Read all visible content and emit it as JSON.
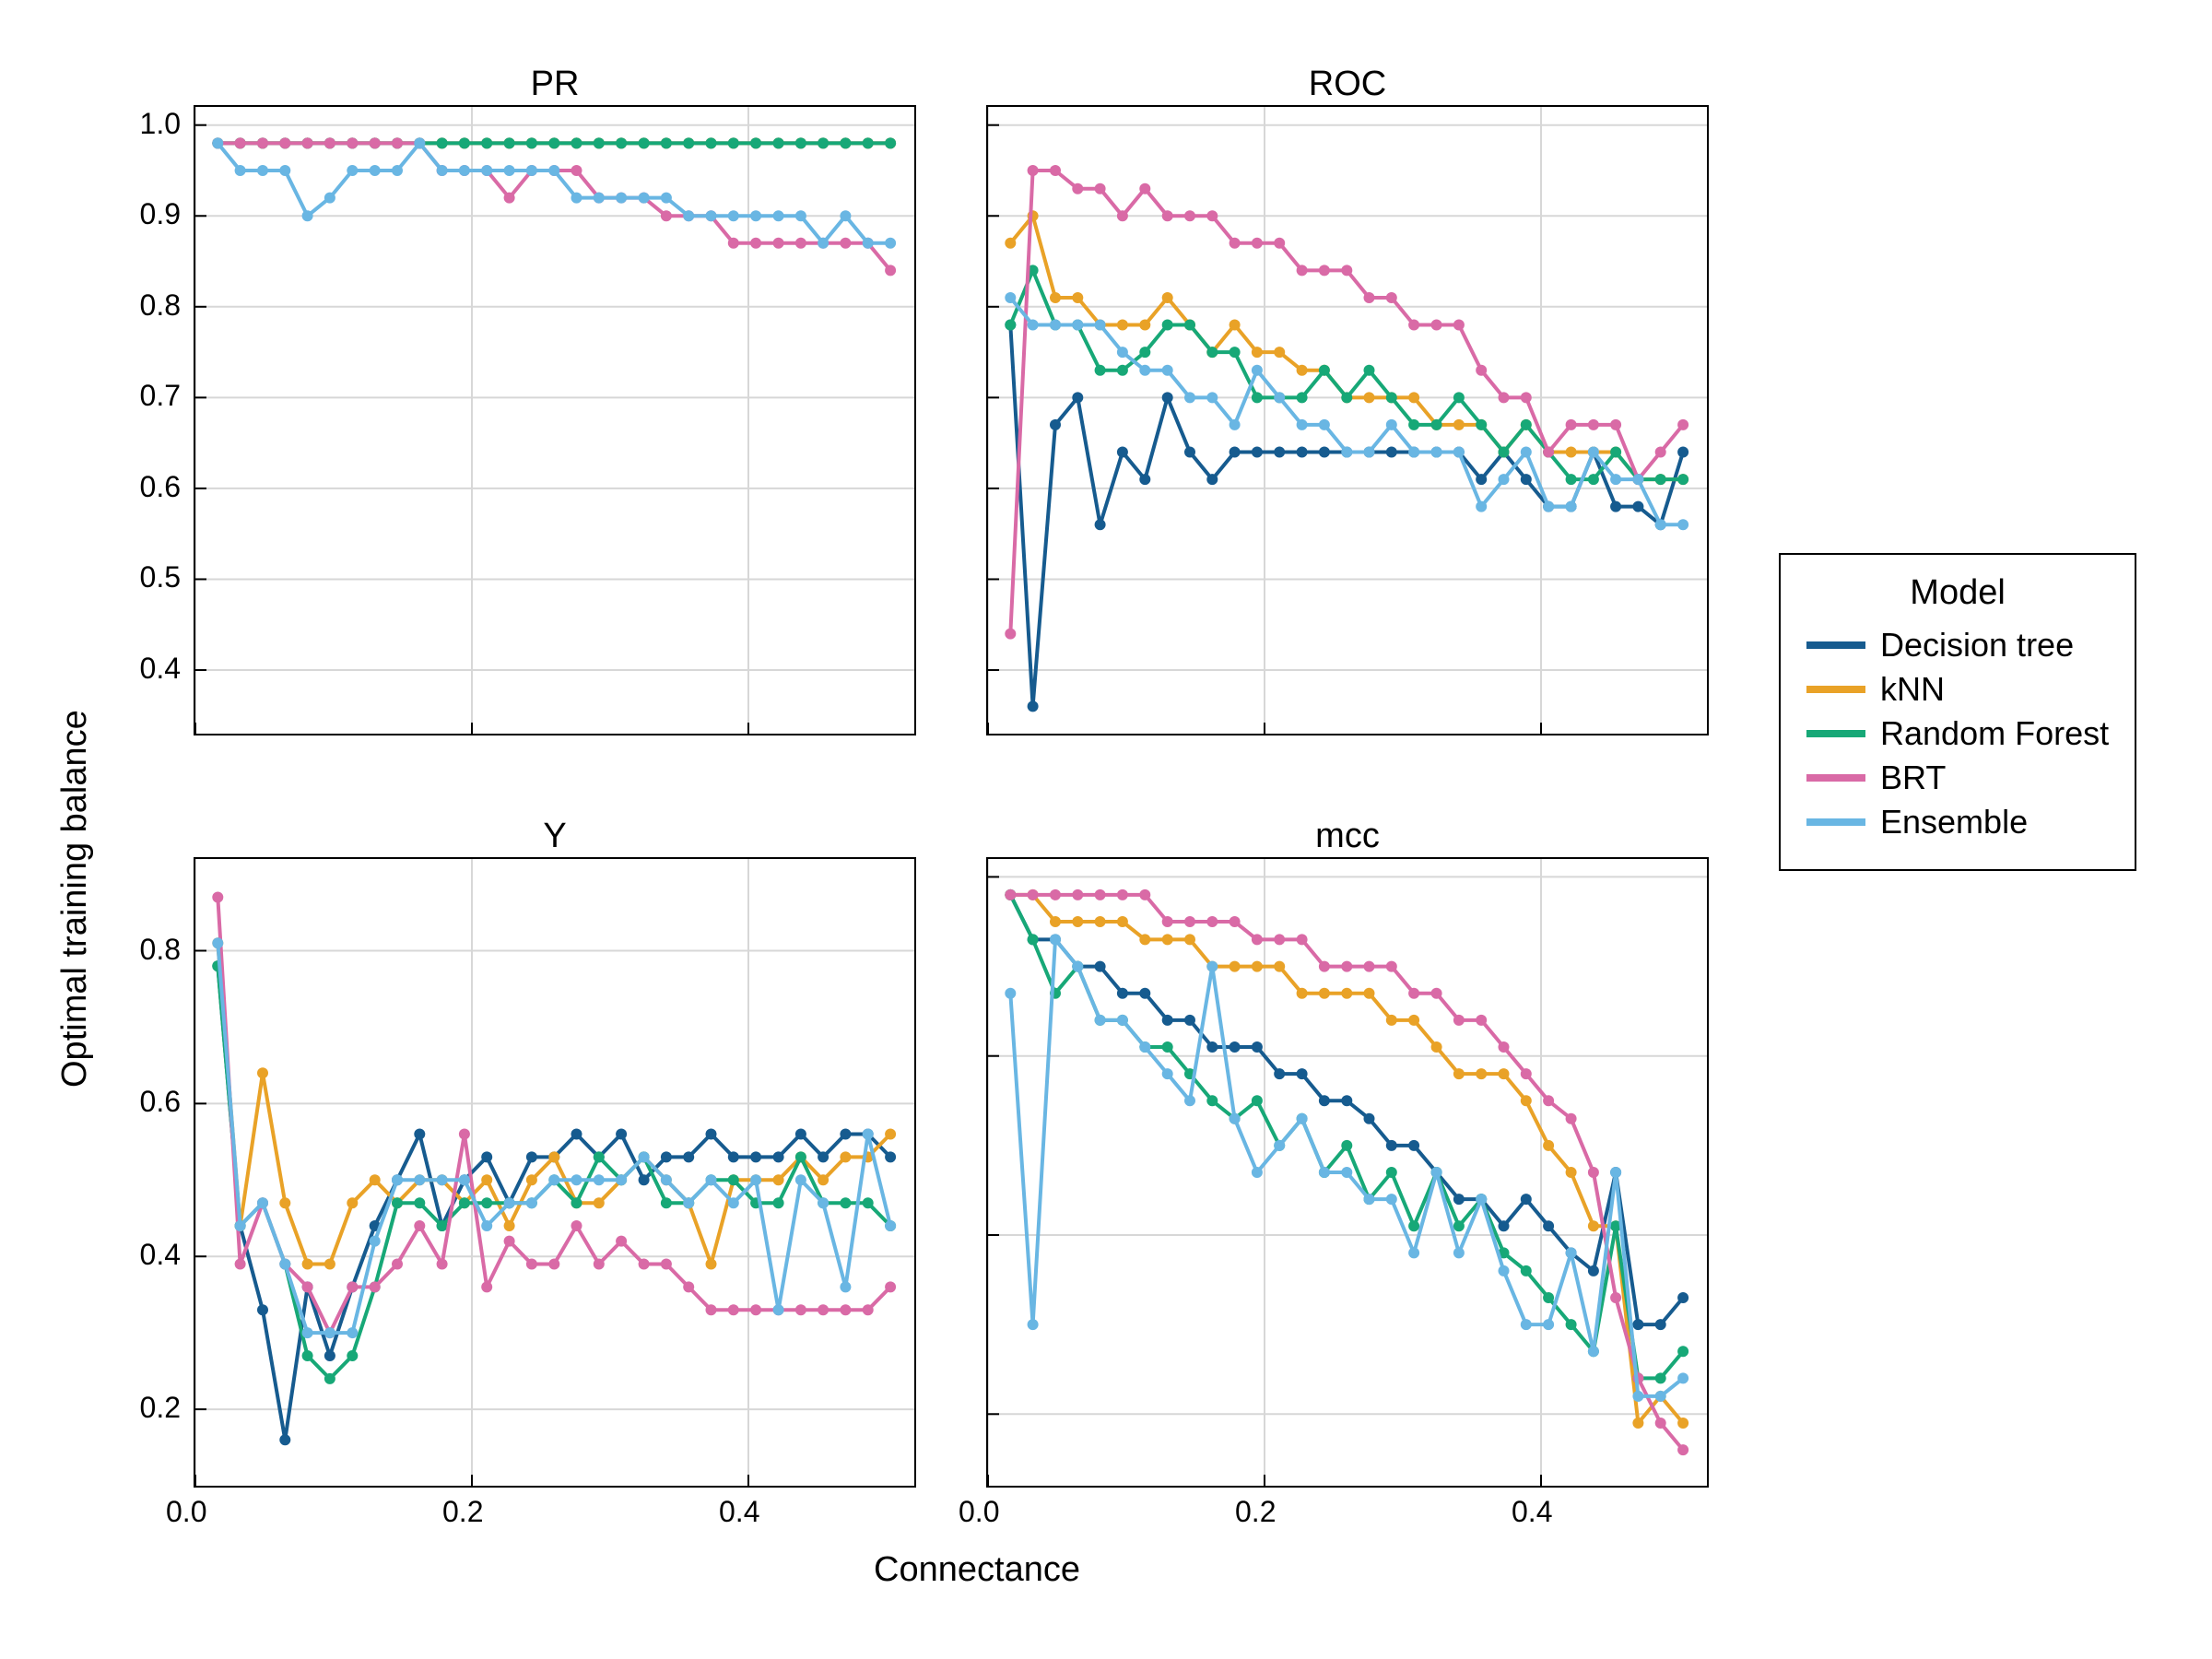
{
  "xlabel": "Connectance",
  "ylabel": "Optimal training balance",
  "x_values": [
    0.0162,
    0.0324,
    0.0487,
    0.0649,
    0.0811,
    0.0973,
    0.1135,
    0.1298,
    0.146,
    0.1622,
    0.1784,
    0.1946,
    0.2108,
    0.2271,
    0.2433,
    0.2595,
    0.2757,
    0.2919,
    0.3081,
    0.3244,
    0.3406,
    0.3568,
    0.373,
    0.3892,
    0.4054,
    0.4217,
    0.4379,
    0.4541,
    0.4703,
    0.4865,
    0.5027
  ],
  "x_ticks": [
    0.0,
    0.2,
    0.4
  ],
  "legend": {
    "title": "Model",
    "entries": [
      {
        "name": "Decision tree",
        "color": "#165b8f"
      },
      {
        "name": "kNN",
        "color": "#e9a227"
      },
      {
        "name": "Random Forest",
        "color": "#17a877"
      },
      {
        "name": "BRT",
        "color": "#d96aa6"
      },
      {
        "name": "Ensemble",
        "color": "#69b6e3"
      }
    ]
  },
  "chart_data": [
    {
      "title": "PR",
      "type": "line",
      "xlabel": "Connectance",
      "ylabel": "Optimal training balance",
      "ylim": [
        0.33,
        1.02
      ],
      "xlim": [
        0.0,
        0.52
      ],
      "yticks": [
        0.4,
        0.5,
        0.6,
        0.7,
        0.8,
        0.9,
        1.0
      ],
      "xticks": [
        0.0,
        0.2,
        0.4
      ],
      "series": [
        {
          "name": "Decision tree",
          "color": "#165b8f",
          "values": [
            0.98,
            0.98,
            0.98,
            0.98,
            0.98,
            0.98,
            0.98,
            0.98,
            0.98,
            0.98,
            0.98,
            0.98,
            0.98,
            0.98,
            0.98,
            0.98,
            0.98,
            0.98,
            0.98,
            0.98,
            0.98,
            0.98,
            0.98,
            0.98,
            0.98,
            0.98,
            0.98,
            0.98,
            0.98,
            0.98,
            0.98
          ]
        },
        {
          "name": "kNN",
          "color": "#e9a227",
          "values": [
            0.98,
            0.98,
            0.98,
            0.98,
            0.98,
            0.98,
            0.98,
            0.98,
            0.98,
            0.98,
            0.98,
            0.98,
            0.98,
            0.98,
            0.98,
            0.98,
            0.98,
            0.98,
            0.98,
            0.98,
            0.98,
            0.98,
            0.98,
            0.98,
            0.98,
            0.98,
            0.98,
            0.98,
            0.98,
            0.98,
            0.98
          ]
        },
        {
          "name": "Random Forest",
          "color": "#17a877",
          "values": [
            0.98,
            0.98,
            0.98,
            0.98,
            0.98,
            0.98,
            0.98,
            0.98,
            0.98,
            0.98,
            0.98,
            0.98,
            0.98,
            0.98,
            0.98,
            0.98,
            0.98,
            0.98,
            0.98,
            0.98,
            0.98,
            0.98,
            0.98,
            0.98,
            0.98,
            0.98,
            0.98,
            0.98,
            0.98,
            0.98,
            0.98
          ]
        },
        {
          "name": "BRT",
          "color": "#d96aa6",
          "values": [
            0.98,
            0.98,
            0.98,
            0.98,
            0.98,
            0.98,
            0.98,
            0.98,
            0.98,
            0.98,
            0.95,
            0.95,
            0.95,
            0.92,
            0.95,
            0.95,
            0.95,
            0.92,
            0.92,
            0.92,
            0.9,
            0.9,
            0.9,
            0.87,
            0.87,
            0.87,
            0.87,
            0.87,
            0.87,
            0.87,
            0.84
          ]
        },
        {
          "name": "Ensemble",
          "color": "#69b6e3",
          "values": [
            0.98,
            0.95,
            0.95,
            0.95,
            0.9,
            0.92,
            0.95,
            0.95,
            0.95,
            0.98,
            0.95,
            0.95,
            0.95,
            0.95,
            0.95,
            0.95,
            0.92,
            0.92,
            0.92,
            0.92,
            0.92,
            0.9,
            0.9,
            0.9,
            0.9,
            0.9,
            0.9,
            0.87,
            0.9,
            0.87,
            0.87
          ]
        }
      ]
    },
    {
      "title": "ROC",
      "type": "line",
      "xlabel": "Connectance",
      "ylabel": "Optimal training balance",
      "ylim": [
        0.33,
        1.02
      ],
      "xlim": [
        0.0,
        0.52
      ],
      "yticks": [
        0.4,
        0.5,
        0.6,
        0.7,
        0.8,
        0.9,
        1.0
      ],
      "xticks": [
        0.0,
        0.2,
        0.4
      ],
      "series": [
        {
          "name": "Decision tree",
          "color": "#165b8f",
          "values": [
            0.78,
            0.36,
            0.67,
            0.7,
            0.56,
            0.64,
            0.61,
            0.7,
            0.64,
            0.61,
            0.64,
            0.64,
            0.64,
            0.64,
            0.64,
            0.64,
            0.64,
            0.64,
            0.64,
            0.64,
            0.64,
            0.61,
            0.64,
            0.61,
            0.58,
            0.58,
            0.64,
            0.58,
            0.58,
            0.56,
            0.64
          ]
        },
        {
          "name": "kNN",
          "color": "#e9a227",
          "values": [
            0.87,
            0.9,
            0.81,
            0.81,
            0.78,
            0.78,
            0.78,
            0.81,
            0.78,
            0.75,
            0.78,
            0.75,
            0.75,
            0.73,
            0.73,
            0.7,
            0.7,
            0.7,
            0.7,
            0.67,
            0.67,
            0.67,
            0.64,
            0.67,
            0.64,
            0.64,
            0.64,
            0.64,
            0.61,
            0.61,
            0.61
          ]
        },
        {
          "name": "Random Forest",
          "color": "#17a877",
          "values": [
            0.78,
            0.84,
            0.78,
            0.78,
            0.73,
            0.73,
            0.75,
            0.78,
            0.78,
            0.75,
            0.75,
            0.7,
            0.7,
            0.7,
            0.73,
            0.7,
            0.73,
            0.7,
            0.67,
            0.67,
            0.7,
            0.67,
            0.64,
            0.67,
            0.64,
            0.61,
            0.61,
            0.64,
            0.61,
            0.61,
            0.61
          ]
        },
        {
          "name": "BRT",
          "color": "#d96aa6",
          "values": [
            0.44,
            0.95,
            0.95,
            0.93,
            0.93,
            0.9,
            0.93,
            0.9,
            0.9,
            0.9,
            0.87,
            0.87,
            0.87,
            0.84,
            0.84,
            0.84,
            0.81,
            0.81,
            0.78,
            0.78,
            0.78,
            0.73,
            0.7,
            0.7,
            0.64,
            0.67,
            0.67,
            0.67,
            0.61,
            0.64,
            0.67
          ]
        },
        {
          "name": "Ensemble",
          "color": "#69b6e3",
          "values": [
            0.81,
            0.78,
            0.78,
            0.78,
            0.78,
            0.75,
            0.73,
            0.73,
            0.7,
            0.7,
            0.67,
            0.73,
            0.7,
            0.67,
            0.67,
            0.64,
            0.64,
            0.67,
            0.64,
            0.64,
            0.64,
            0.58,
            0.61,
            0.64,
            0.58,
            0.58,
            0.64,
            0.61,
            0.61,
            0.56,
            0.56
          ]
        }
      ]
    },
    {
      "title": "Y",
      "type": "line",
      "xlabel": "Connectance",
      "ylabel": "Optimal training balance",
      "ylim": [
        0.1,
        0.92
      ],
      "xlim": [
        0.0,
        0.52
      ],
      "yticks": [
        0.2,
        0.4,
        0.6,
        0.8
      ],
      "xticks": [
        0.0,
        0.2,
        0.4
      ],
      "series": [
        {
          "name": "Decision tree",
          "color": "#165b8f",
          "values": [
            0.78,
            0.44,
            0.33,
            0.16,
            0.36,
            0.27,
            0.36,
            0.44,
            0.5,
            0.56,
            0.44,
            0.5,
            0.53,
            0.47,
            0.53,
            0.53,
            0.56,
            0.53,
            0.56,
            0.5,
            0.53,
            0.53,
            0.56,
            0.53,
            0.53,
            0.53,
            0.56,
            0.53,
            0.56,
            0.56,
            0.53
          ]
        },
        {
          "name": "kNN",
          "color": "#e9a227",
          "values": [
            0.81,
            0.44,
            0.64,
            0.47,
            0.39,
            0.39,
            0.47,
            0.5,
            0.47,
            0.5,
            0.5,
            0.47,
            0.5,
            0.44,
            0.5,
            0.53,
            0.47,
            0.47,
            0.5,
            0.53,
            0.5,
            0.47,
            0.39,
            0.5,
            0.5,
            0.5,
            0.53,
            0.5,
            0.53,
            0.53,
            0.56
          ]
        },
        {
          "name": "Random Forest",
          "color": "#17a877",
          "values": [
            0.78,
            0.44,
            0.47,
            0.39,
            0.27,
            0.24,
            0.27,
            0.36,
            0.47,
            0.47,
            0.44,
            0.47,
            0.47,
            0.47,
            0.47,
            0.5,
            0.47,
            0.53,
            0.5,
            0.53,
            0.47,
            0.47,
            0.5,
            0.5,
            0.47,
            0.47,
            0.53,
            0.47,
            0.47,
            0.47,
            0.44
          ]
        },
        {
          "name": "BRT",
          "color": "#d96aa6",
          "values": [
            0.87,
            0.39,
            0.47,
            0.39,
            0.36,
            0.3,
            0.36,
            0.36,
            0.39,
            0.44,
            0.39,
            0.56,
            0.36,
            0.42,
            0.39,
            0.39,
            0.44,
            0.39,
            0.42,
            0.39,
            0.39,
            0.36,
            0.33,
            0.33,
            0.33,
            0.33,
            0.33,
            0.33,
            0.33,
            0.33,
            0.36
          ]
        },
        {
          "name": "Ensemble",
          "color": "#69b6e3",
          "values": [
            0.81,
            0.44,
            0.47,
            0.39,
            0.3,
            0.3,
            0.3,
            0.42,
            0.5,
            0.5,
            0.5,
            0.5,
            0.44,
            0.47,
            0.47,
            0.5,
            0.5,
            0.5,
            0.5,
            0.53,
            0.5,
            0.47,
            0.5,
            0.47,
            0.5,
            0.33,
            0.5,
            0.47,
            0.36,
            0.56,
            0.44
          ]
        }
      ]
    },
    {
      "title": "mcc",
      "type": "line",
      "xlabel": "Connectance",
      "ylabel": "Optimal training balance",
      "ylim": [
        0.32,
        1.02
      ],
      "xlim": [
        0.0,
        0.52
      ],
      "yticks": [
        0.4,
        0.6,
        0.8,
        1.0
      ],
      "xticks": [
        0.0,
        0.2,
        0.4
      ],
      "series": [
        {
          "name": "Decision tree",
          "color": "#165b8f",
          "values": [
            0.98,
            0.93,
            0.93,
            0.9,
            0.9,
            0.87,
            0.87,
            0.84,
            0.84,
            0.81,
            0.81,
            0.81,
            0.78,
            0.78,
            0.75,
            0.75,
            0.73,
            0.7,
            0.7,
            0.67,
            0.64,
            0.64,
            0.61,
            0.64,
            0.61,
            0.58,
            0.56,
            0.67,
            0.5,
            0.5,
            0.53
          ]
        },
        {
          "name": "kNN",
          "color": "#e9a227",
          "values": [
            0.98,
            0.98,
            0.95,
            0.95,
            0.95,
            0.95,
            0.93,
            0.93,
            0.93,
            0.9,
            0.9,
            0.9,
            0.9,
            0.87,
            0.87,
            0.87,
            0.87,
            0.84,
            0.84,
            0.81,
            0.78,
            0.78,
            0.78,
            0.75,
            0.7,
            0.67,
            0.61,
            0.61,
            0.39,
            0.42,
            0.39
          ]
        },
        {
          "name": "Random Forest",
          "color": "#17a877",
          "values": [
            0.98,
            0.93,
            0.87,
            0.9,
            0.84,
            0.84,
            0.81,
            0.81,
            0.78,
            0.75,
            0.73,
            0.75,
            0.7,
            0.73,
            0.67,
            0.7,
            0.64,
            0.67,
            0.61,
            0.67,
            0.61,
            0.64,
            0.58,
            0.56,
            0.53,
            0.5,
            0.47,
            0.61,
            0.44,
            0.44,
            0.47
          ]
        },
        {
          "name": "BRT",
          "color": "#d96aa6",
          "values": [
            0.98,
            0.98,
            0.98,
            0.98,
            0.98,
            0.98,
            0.98,
            0.95,
            0.95,
            0.95,
            0.95,
            0.93,
            0.93,
            0.93,
            0.9,
            0.9,
            0.9,
            0.9,
            0.87,
            0.87,
            0.84,
            0.84,
            0.81,
            0.78,
            0.75,
            0.73,
            0.67,
            0.53,
            0.44,
            0.39,
            0.36
          ]
        },
        {
          "name": "Ensemble",
          "color": "#69b6e3",
          "values": [
            0.87,
            0.5,
            0.93,
            0.9,
            0.84,
            0.84,
            0.81,
            0.78,
            0.75,
            0.9,
            0.73,
            0.67,
            0.7,
            0.73,
            0.67,
            0.67,
            0.64,
            0.64,
            0.58,
            0.67,
            0.58,
            0.64,
            0.56,
            0.5,
            0.5,
            0.58,
            0.47,
            0.67,
            0.42,
            0.42,
            0.44
          ]
        }
      ]
    }
  ]
}
